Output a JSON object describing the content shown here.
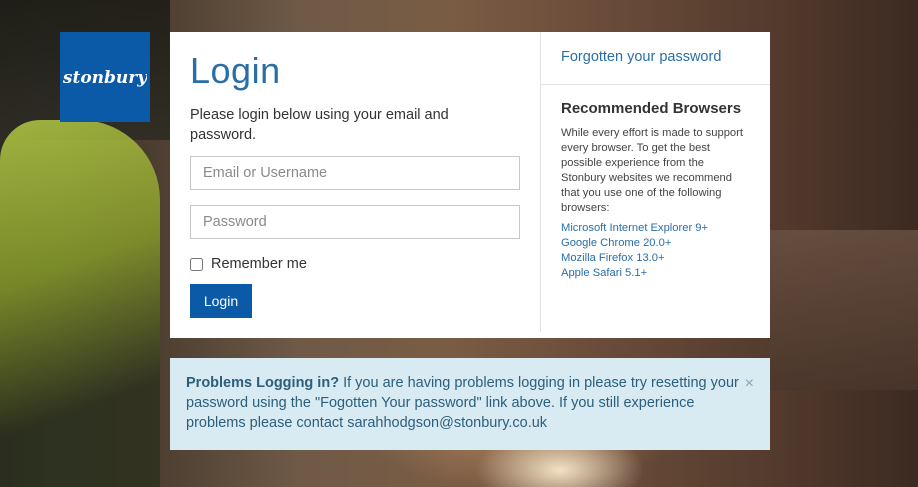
{
  "brand": {
    "logo_text": "stonbury",
    "logo_color": "#0b5aa8"
  },
  "login": {
    "title": "Login",
    "instructions": "Please login below using your email and password.",
    "email_placeholder": "Email or Username",
    "password_placeholder": "Password",
    "remember_label": "Remember me",
    "remember_checked": false,
    "button_label": "Login"
  },
  "sidebar": {
    "forgot_link": "Forgotten your password",
    "browsers_title": "Recommended Browsers",
    "browsers_description": "While every effort is made to support every browser. To get the best possible experience from the Stonbury websites we recommend that you use one of the following browsers:",
    "browsers": [
      "Microsoft Internet Explorer 9+",
      "Google Chrome 20.0+",
      "Mozilla Firefox 13.0+",
      "Apple Safari 5.1+"
    ]
  },
  "alert": {
    "title": "Problems Logging in?",
    "message_part1": "If you are having problems logging in please try resetting your password using the \"Fogotten Your password\" link above. If you still experience problems please contact ",
    "contact_email": "sarahhodgson@stonbury.co.uk",
    "close_icon": "×"
  },
  "colors": {
    "accent": "#2a6ea8",
    "button": "#0b5aa8",
    "alert_bg": "#d8eaf2"
  }
}
